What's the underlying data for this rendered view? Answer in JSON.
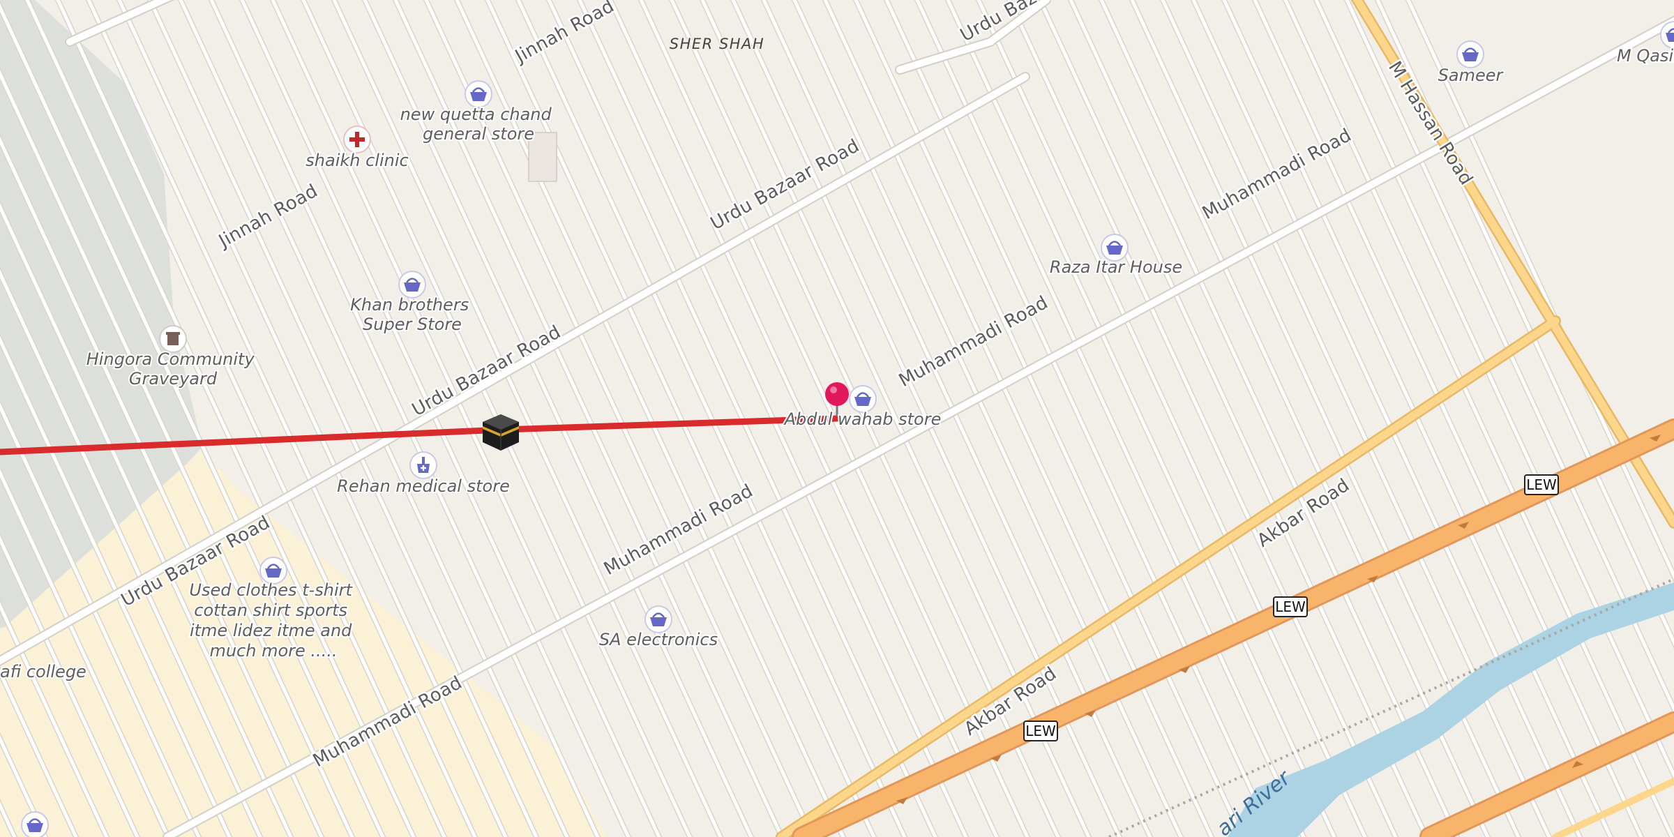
{
  "map": {
    "area_name": "SHER SHAH",
    "streets": {
      "jinnah_a": "Jinnah Road",
      "jinnah_b": "Jinnah Road",
      "urdu_a": "Urdu Bazaar Road",
      "urdu_b": "Urdu Bazaar Road",
      "urdu_c": "Urdu Bazaar Road",
      "urdu_d": "Urdu Baz",
      "muhammadi_a": "Muhammadi Road",
      "muhammadi_b": "Muhammadi Road",
      "muhammadi_c": "Muhammadi Road",
      "muhammadi_d": "Muhammadi Road",
      "akbar_a": "Akbar Road",
      "akbar_b": "Akbar Road",
      "hassan": "M Hassan Road"
    },
    "highway_ref": "LEW",
    "river_name": "ari River",
    "pois": {
      "new_quetta": [
        "new quetta chand",
        "general store"
      ],
      "shaikh_clinic": "shaikh clinic",
      "khan_brothers": [
        "Khan brothers",
        "Super Store"
      ],
      "graveyard": [
        "Hingora Community",
        "Graveyard"
      ],
      "rehan": "Rehan medical store",
      "used_clothes": [
        "Used clothes t-shirt",
        "cottan shirt sports",
        "itme lidez itme and",
        "much more ....."
      ],
      "college": "afi college",
      "sa_electronics": "SA electronics",
      "abdul_wahab": "Abdul wahab store",
      "raza": "Raza Itar House",
      "sameer": "Sameer",
      "m_qasim": "M Qasim"
    },
    "icons": {
      "shop": "shopping-basket-icon",
      "clinic": "red-cross-icon",
      "pharmacy": "pharmacy-icon",
      "graveyard": "grave-icon",
      "kaaba": "kaaba-icon",
      "pin": "map-pin-icon"
    },
    "colors": {
      "background": "#f2efe9",
      "road": "#ffffff",
      "road_casing": "#d4cfc6",
      "primary_road": "#fcd68a",
      "trunk": "#f8b46a",
      "river": "#abd3e3",
      "landuse_grey": "#dde0da",
      "landuse_cream": "#fbf1d6",
      "route_line": "#d92b2b",
      "shop_icon": "#6668c7",
      "pin": "#e3175b"
    }
  }
}
